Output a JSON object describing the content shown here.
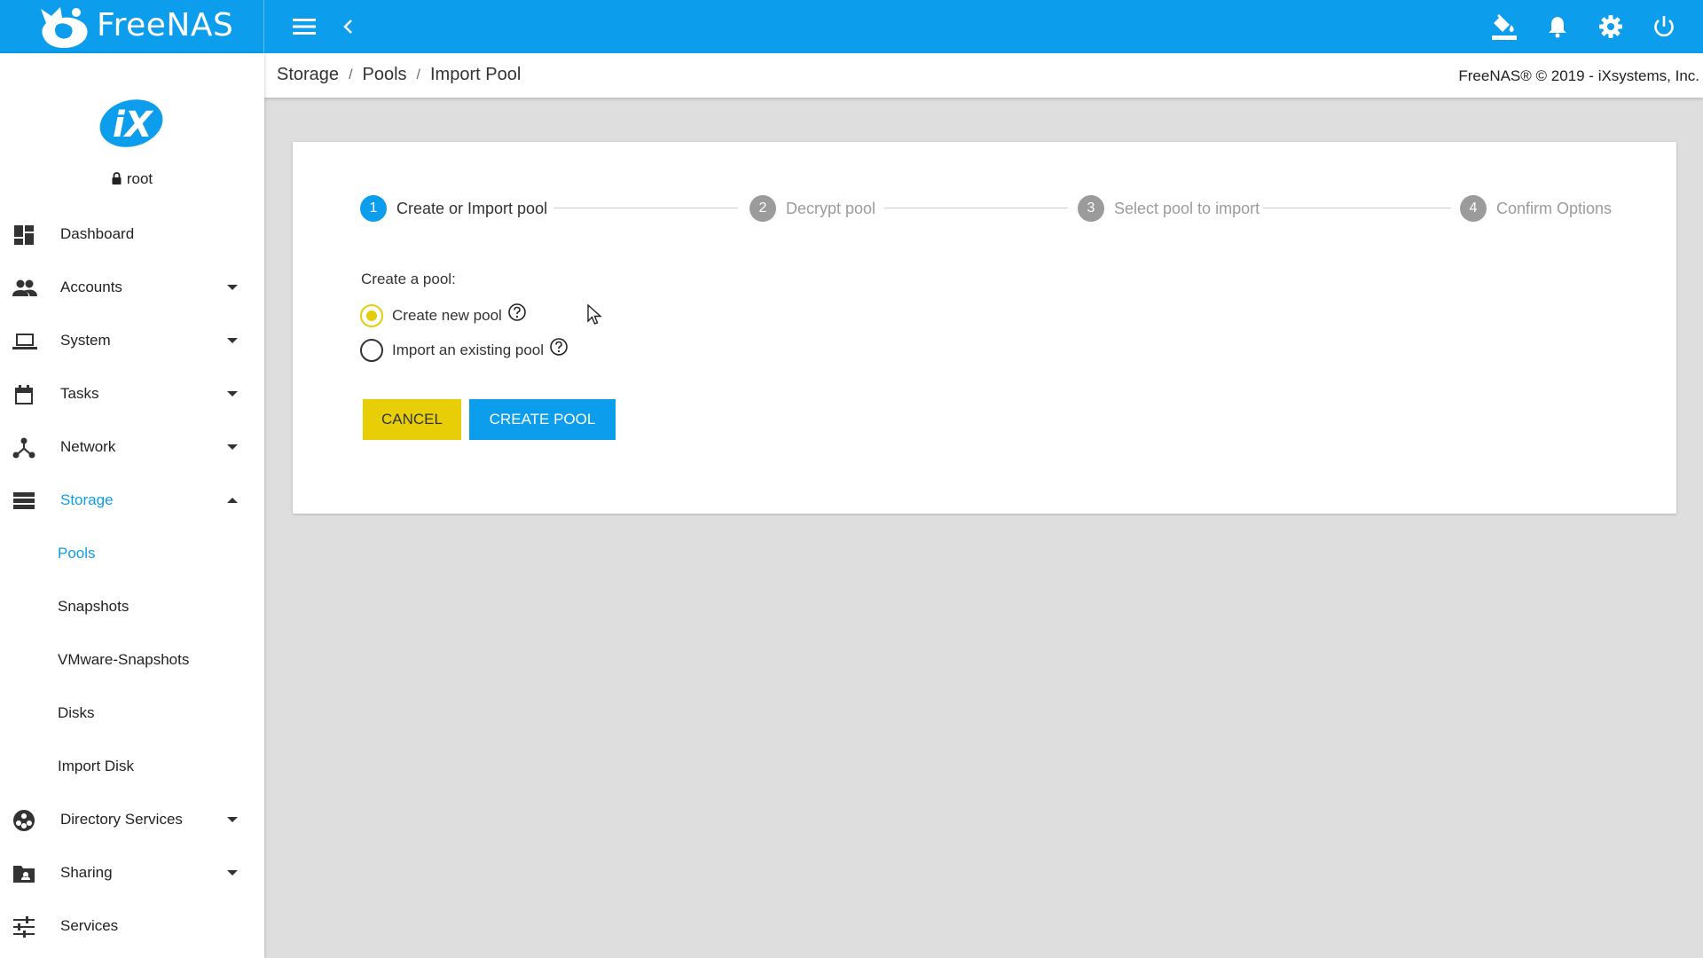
{
  "app": {
    "brand_name": "FreeNAS",
    "brand_tm": "™",
    "copyright": "FreeNAS® © 2019 - iXsystems, Inc."
  },
  "topbar": {
    "icons": [
      "menu-icon",
      "chevron-left-icon",
      "paint-bucket-icon",
      "bell-icon",
      "gear-icon",
      "power-icon"
    ]
  },
  "breadcrumb": {
    "items": [
      "Storage",
      "Pools",
      "Import Pool"
    ],
    "separator": "/"
  },
  "sidebar": {
    "user": "root",
    "items": [
      {
        "label": "Dashboard",
        "icon": "dashboard-icon"
      },
      {
        "label": "Accounts",
        "icon": "people-icon"
      },
      {
        "label": "System",
        "icon": "laptop-icon"
      },
      {
        "label": "Tasks",
        "icon": "calendar-icon"
      },
      {
        "label": "Network",
        "icon": "network-icon"
      },
      {
        "label": "Storage",
        "icon": "storage-icon"
      },
      {
        "label": "Directory Services",
        "icon": "directory-icon"
      },
      {
        "label": "Sharing",
        "icon": "folder-share-icon"
      },
      {
        "label": "Services",
        "icon": "sliders-icon"
      }
    ],
    "storage_sub": [
      "Pools",
      "Snapshots",
      "VMware-Snapshots",
      "Disks",
      "Import Disk"
    ]
  },
  "wizard": {
    "steps": [
      {
        "num": "1",
        "label": "Create or Import pool"
      },
      {
        "num": "2",
        "label": "Decrypt pool"
      },
      {
        "num": "3",
        "label": "Select pool to import"
      },
      {
        "num": "4",
        "label": "Confirm Options"
      }
    ],
    "form_label": "Create a pool:",
    "options": [
      "Create new pool",
      "Import an existing pool"
    ],
    "selected_option": "Create new pool",
    "cancel_label": "CANCEL",
    "create_label": "CREATE POOL"
  },
  "colors": {
    "primary": "#0d9ded",
    "accent": "#e8ce07",
    "inactive": "#9b9b9b"
  }
}
